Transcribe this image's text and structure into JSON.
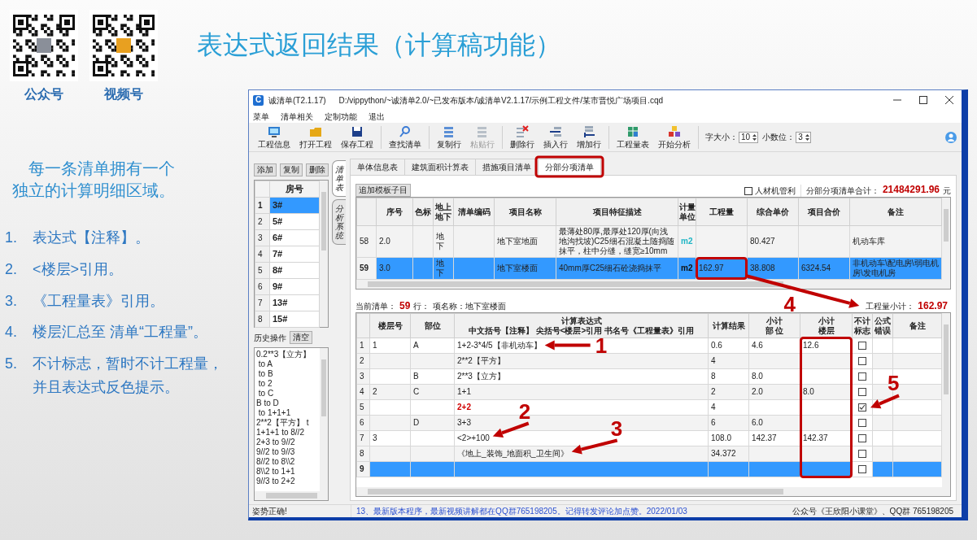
{
  "slide": {
    "title": "表达式返回结果（计算稿功能）",
    "qr_codes": [
      {
        "label": "公众号"
      },
      {
        "label": "视频号"
      }
    ],
    "intro": "每一条清单拥有一个独立的计算明细区域。",
    "points": [
      {
        "number": "1.",
        "text": "表达式【注释】。"
      },
      {
        "number": "2.",
        "text": "<楼层>引用。"
      },
      {
        "number": "3.",
        "text": "《工程量表》引用。"
      },
      {
        "number": "4.",
        "text": "楼层汇总至 清单“工程量”。"
      },
      {
        "number": "5.",
        "text": "不计标志，暂时不计工程量，并且表达式反色提示。"
      }
    ]
  },
  "window": {
    "logo": "C",
    "title": "诚清单(T2.1.17)",
    "path": "D:/vippython/~诚清单2.0/~已发布版本/诚清单V2.1.17/示例工程文件/某市晋悦广场项目.cqd",
    "menu": [
      "菜单",
      "清单相关",
      "定制功能",
      "退出"
    ],
    "toolbar": [
      [
        {
          "label": "工程信息",
          "disabled": false
        },
        {
          "label": "打开工程",
          "disabled": false
        },
        {
          "label": "保存工程",
          "disabled": false
        }
      ],
      [
        {
          "label": "查找清单",
          "disabled": false
        }
      ],
      [
        {
          "label": "复制行",
          "disabled": false
        },
        {
          "label": "粘贴行",
          "disabled": true
        }
      ],
      [
        {
          "label": "删除行",
          "disabled": false
        },
        {
          "label": "插入行",
          "disabled": false
        },
        {
          "label": "增加行",
          "disabled": false
        }
      ],
      [
        {
          "label": "工程量表",
          "disabled": false
        },
        {
          "label": "开始分析",
          "disabled": false
        }
      ]
    ],
    "spinners": [
      {
        "label": "字大小：",
        "value": "10"
      },
      {
        "label": "小数位：",
        "value": "3"
      }
    ],
    "left_panel": {
      "buttons": [
        "添加",
        "复制",
        "删除"
      ],
      "rooms_header": "房号",
      "rooms": [
        {
          "index": "1",
          "name": "3#",
          "selected": true
        },
        {
          "index": "2",
          "name": "5#",
          "selected": false
        },
        {
          "index": "3",
          "name": "6#",
          "selected": false
        },
        {
          "index": "4",
          "name": "7#",
          "selected": false
        },
        {
          "index": "5",
          "name": "8#",
          "selected": false
        },
        {
          "index": "6",
          "name": "9#",
          "selected": false
        },
        {
          "index": "7",
          "name": "13#",
          "selected": false
        },
        {
          "index": "8",
          "name": "15#",
          "selected": false
        }
      ],
      "history_label": "历史操作",
      "history_button": "清空",
      "history": [
        "0.2**3【立方】",
        " to A",
        " to B",
        " to 2",
        " to C",
        "B to D",
        " to 1+1+1",
        "2**2【平方】 t",
        "1+1+1 to 8//2",
        "2+3 to 9//2",
        "9//2 to 9//3",
        "8//2 to 8\\\\2",
        "8\\\\2 to 1+1",
        "9//3 to 2+2"
      ]
    },
    "side_tabs": [
      {
        "label": "清单表",
        "selected": true
      },
      {
        "label": "分析系统",
        "selected": false
      }
    ],
    "tabs": [
      {
        "label": "单体信息表",
        "selected": false
      },
      {
        "label": "建筑面积计算表",
        "selected": false
      },
      {
        "label": "措施项目清单",
        "selected": false
      },
      {
        "label": "分部分项清单",
        "selected": true
      }
    ],
    "add_template_button": "追加模板子目",
    "option_checkbox": {
      "label": "人材机管利",
      "checked": false
    },
    "total_label": "分部分项清单合计：",
    "total_value": "21484291.96",
    "total_unit": "元",
    "upper_table": {
      "columns": [
        "序号",
        "色标",
        "地上地下",
        "清单编码",
        "项目名称",
        "项目特征描述",
        "计量单位",
        "工程量",
        "综合单价",
        "项目合价",
        "备注"
      ],
      "rows": [
        {
          "index": "58",
          "seq": "2.0",
          "above_below": "地下",
          "name": "地下室地面",
          "description": "最薄处80厚,最厚处120厚(向浅地沟找坡)C25细石混凝土随捣随抹平，柱中分缝，缝宽≥10mm",
          "unit": "m2",
          "unit_price": "80.427",
          "remark": "机动车库",
          "selected": false
        },
        {
          "index": "59",
          "seq": "3.0",
          "above_below": "地下",
          "name": "地下室楼面",
          "description": "40mm厚C25细石砼浇捣抹平",
          "unit": "m2",
          "quantity": "162.97",
          "unit_price": "38.808",
          "total": "6324.54",
          "remark": "非机动车\\配电房\\弱电机房\\发电机房",
          "selected": true
        }
      ]
    },
    "detail_info": {
      "current_label": "当前清单：",
      "row": "59",
      "row_suffix": "行：",
      "name_label": "项名称：",
      "name": "地下室楼面",
      "subtotal_label": "工程量小计：",
      "subtotal": "162.97"
    },
    "lower_table": {
      "columns": [
        [
          "楼层号"
        ],
        [
          "部位"
        ],
        [
          "计算表达式",
          "中文括号【注释】 尖括号<楼层>引用 书名号《工程量表》引用"
        ],
        [
          "计算结果"
        ],
        [
          "小计",
          "部 位"
        ],
        [
          "小计",
          "楼层"
        ],
        [
          "不计",
          "标志"
        ],
        [
          "公式",
          "错误"
        ],
        [
          "备注"
        ]
      ],
      "rows": [
        {
          "index": "1",
          "floor": "1",
          "part": "A",
          "expression": "1+2-3*4/5【非机动车】",
          "result": "0.6",
          "part_subtotal": "4.6",
          "floor_subtotal": "12.6",
          "excluded": false,
          "selected": false
        },
        {
          "index": "2",
          "expression": "2**2【平方】",
          "result": "4",
          "excluded": false,
          "selected": false
        },
        {
          "index": "3",
          "part": "B",
          "expression": "2**3【立方】",
          "result": "8",
          "part_subtotal": "8.0",
          "excluded": false,
          "selected": false
        },
        {
          "index": "4",
          "floor": "2",
          "part": "C",
          "expression": "1+1",
          "result": "2",
          "part_subtotal": "2.0",
          "floor_subtotal": "8.0",
          "excluded": false,
          "selected": false
        },
        {
          "index": "5",
          "expression": "2+2",
          "result": "4",
          "excluded": true,
          "selected": false
        },
        {
          "index": "6",
          "part": "D",
          "expression": "3+3",
          "result": "6",
          "part_subtotal": "6.0",
          "excluded": false,
          "selected": false
        },
        {
          "index": "7",
          "floor": "3",
          "expression": "<2>+100",
          "result": "108.0",
          "part_subtotal": "142.37",
          "floor_subtotal": "142.37",
          "excluded": false,
          "selected": false
        },
        {
          "index": "8",
          "expression": "《地上_装饰_地面积_卫生间》",
          "result": "34.372",
          "excluded": false,
          "selected": false
        },
        {
          "index": "9",
          "excluded": false,
          "selected": true
        }
      ]
    },
    "status": [
      "姿势正确!",
      "13、最新版本程序，最新视频讲解都在QQ群765198205。记得转发评论加点赞。2022/01/03",
      "公众号《王欣阳小课堂》、QQ群 765198205"
    ]
  },
  "annotations": [
    {
      "label": "1"
    },
    {
      "label": "2"
    },
    {
      "label": "3"
    },
    {
      "label": "4"
    },
    {
      "label": "5"
    }
  ]
}
